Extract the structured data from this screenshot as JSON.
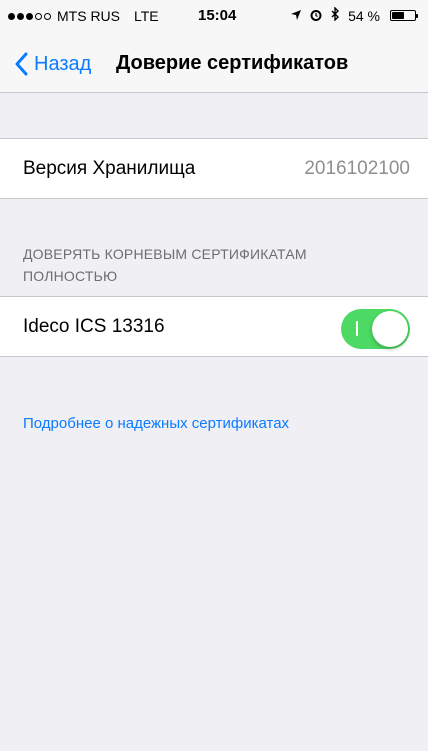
{
  "status_bar": {
    "carrier": "MTS RUS",
    "network": "LTE",
    "time": "15:04",
    "battery": "54 %",
    "icons": [
      "signal-dots",
      "location-arrow-icon",
      "alarm-icon",
      "bluetooth-icon",
      "battery-icon"
    ]
  },
  "nav": {
    "back_label": "Назад",
    "title": "Доверие сертификатов"
  },
  "store_version": {
    "label": "Версия Хранилища",
    "value": "2016102100"
  },
  "trust_section": {
    "header": "ДОВЕРЯТЬ КОРНЕВЫМ СЕРТИФИКАТАМ ПОЛНОСТЬЮ",
    "items": [
      {
        "label": "Ideco ICS 13316",
        "enabled": true
      }
    ]
  },
  "footer_link": "Подробнее о надежных сертификатах",
  "colors": {
    "accent": "#0b7bff",
    "toggle_on": "#4cd964",
    "background": "#efeff4",
    "secondary_text": "#8e8e93"
  }
}
